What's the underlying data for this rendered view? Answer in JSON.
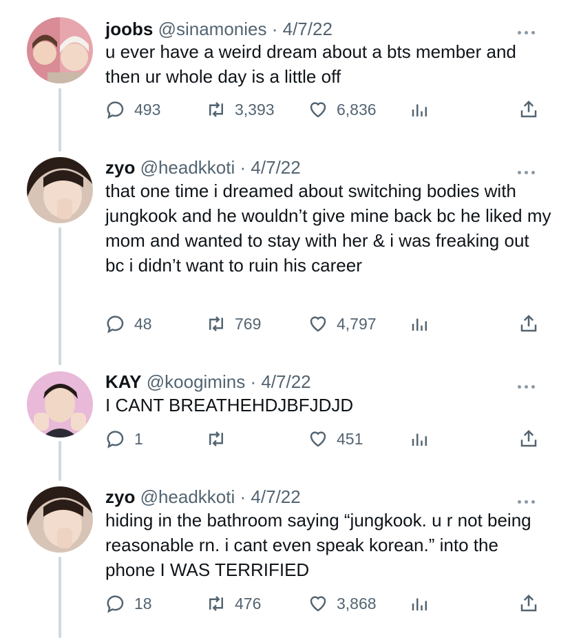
{
  "tweets": [
    {
      "name": "joobs",
      "handle": "@sinamonies",
      "sep": "·",
      "date": "4/7/22",
      "text": "u ever have a weird dream about a bts member and then ur whole day is a little off",
      "replies": "493",
      "retweets": "3,393",
      "likes": "6,836",
      "avatar_bg": "#e8a9b0"
    },
    {
      "name": "zyo",
      "handle": "@headkkoti",
      "sep": "·",
      "date": "4/7/22",
      "text": "that one time i dreamed about switching bodies with jungkook and he wouldn’t give mine back bc he liked my mom and wanted to stay with her & i was freaking out bc i didn’t want to ruin his career",
      "replies": "48",
      "retweets": "769",
      "likes": "4,797",
      "avatar_bg": "#d9c5b8"
    },
    {
      "name": "KAY",
      "handle": "@koogimins",
      "sep": "·",
      "date": "4/7/22",
      "text": "I CANT BREATHEHDJBFJDJD",
      "replies": "1",
      "retweets": "",
      "likes": "451",
      "avatar_bg": "#e6b6d6"
    },
    {
      "name": "zyo",
      "handle": "@headkkoti",
      "sep": "·",
      "date": "4/7/22",
      "text": "hiding in the bathroom saying “jungkook. u r not being reasonable rn. i cant even speak korean.” into the phone I WAS TERRIFIED",
      "replies": "18",
      "retweets": "476",
      "likes": "3,868",
      "avatar_bg": "#d9c5b8"
    }
  ],
  "icons": {
    "reply": "reply-icon",
    "retweet": "retweet-icon",
    "like": "heart-icon",
    "stats": "analytics-icon",
    "share": "share-icon",
    "more": "more-icon"
  },
  "colors": {
    "text": "#0f1419",
    "secondary": "#536471",
    "thread_line": "#cfd9de"
  }
}
